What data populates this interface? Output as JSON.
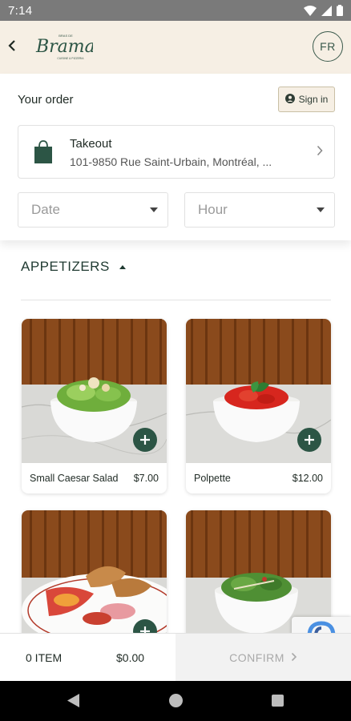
{
  "status_bar": {
    "time": "7:14"
  },
  "header": {
    "logo_text": "Brama",
    "logo_small_top": "BRAS DE",
    "logo_small_bottom": "CUISINE & PIZZERIA",
    "language_label": "FR"
  },
  "order": {
    "title": "Your order",
    "signin_label": "Sign in",
    "mode_title": "Takeout",
    "address": "101-9850 Rue Saint-Urbain, Montréal, ...",
    "date_placeholder": "Date",
    "hour_placeholder": "Hour"
  },
  "menu": {
    "section_title": "APPETIZERS",
    "items": [
      {
        "name": "Small Caesar Salad",
        "price": "$7.00"
      },
      {
        "name": "Polpette",
        "price": "$12.00"
      },
      {
        "name": "",
        "price": ""
      },
      {
        "name": "",
        "price": ""
      }
    ]
  },
  "cart": {
    "count_label": "0 ITEM",
    "total": "$0.00",
    "confirm_label": "CONFIRM"
  },
  "colors": {
    "brand_green": "#2c5545",
    "header_bg": "#f6efe4",
    "accent_border": "#c9bfa5"
  }
}
